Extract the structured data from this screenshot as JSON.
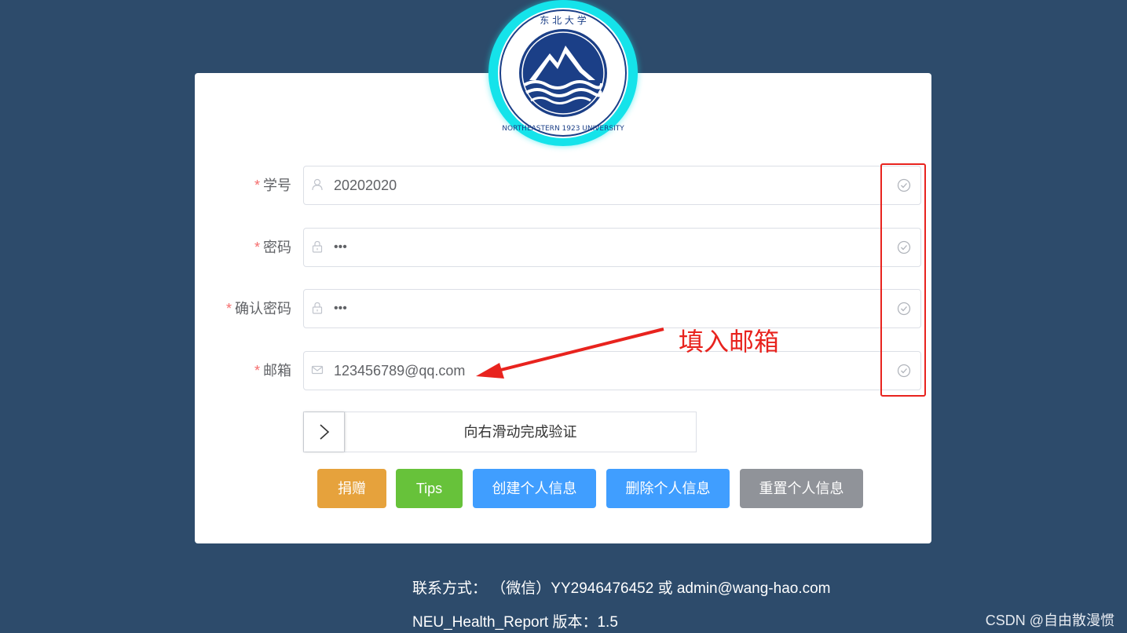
{
  "logo": {
    "text_arc": "NORTHEASTERN 1923 UNIVERSITY",
    "seal_chars": "东北大学"
  },
  "form": {
    "fields": [
      {
        "label": "学号",
        "value": "20202020",
        "icon": "user-icon"
      },
      {
        "label": "密码",
        "value": "•••",
        "icon": "lock-icon"
      },
      {
        "label": "确认密码",
        "value": "•••",
        "icon": "lock-icon"
      },
      {
        "label": "邮箱",
        "value": "123456789@qq.com",
        "icon": "mail-icon"
      }
    ],
    "required_mark": "*",
    "valid_icon": "check-circle-icon"
  },
  "slider": {
    "text": "向右滑动完成验证",
    "icon": "chevron-right-icon"
  },
  "buttons": {
    "donate": "捐赠",
    "tips": "Tips",
    "create": "创建个人信息",
    "delete": "删除个人信息",
    "reset": "重置个人信息"
  },
  "colors": {
    "background": "#2d4b6b",
    "donate": "#e6a23c",
    "tips": "#67c23a",
    "primary": "#409eff",
    "info": "#909399",
    "annotation": "#e8231e",
    "logo_ring": "#15e3ea"
  },
  "annotation": {
    "text": "填入邮箱"
  },
  "footer": {
    "contact": "联系方式： （微信）YY2946476452 或 admin@wang-hao.com",
    "version": "NEU_Health_Report 版本：1.5"
  },
  "watermark": "CSDN @自由散漫惯"
}
